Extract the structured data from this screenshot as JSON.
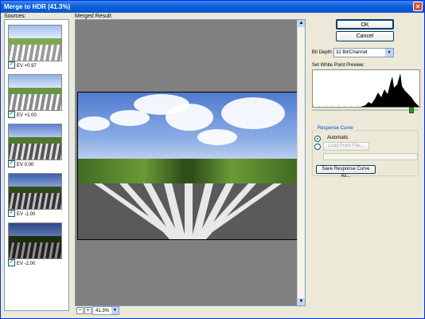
{
  "window": {
    "title": "Merge to HDR (41.3%)",
    "close_glyph": "×"
  },
  "sources": {
    "label": "Sources:",
    "items": [
      {
        "label": "EV +0.97",
        "checked": true
      },
      {
        "label": "EV +1.00",
        "checked": true
      },
      {
        "label": "EV 0.00",
        "checked": true
      },
      {
        "label": "EV -1.00",
        "checked": true
      },
      {
        "label": "EV -2.00",
        "checked": true
      }
    ]
  },
  "preview": {
    "label": "Merged Result:"
  },
  "zoom": {
    "minus": "−",
    "plus": "+",
    "value": "41.3%"
  },
  "buttons": {
    "ok": "OK",
    "cancel": "Cancel"
  },
  "bit_depth": {
    "label": "Bit Depth:",
    "value": "32 Bit/Channel"
  },
  "white_point": {
    "label": "Set White Point Preview:",
    "level": 0.93
  },
  "response_curve": {
    "title": "Response Curve",
    "automatic_label": "Automatic",
    "load_label": "Load From File...",
    "save_label": "Save Response Curve As...",
    "selected": "automatic"
  },
  "icons": {
    "check": "✓",
    "dropdown": "▼",
    "scroll_up": "▲",
    "scroll_down": "▼"
  }
}
